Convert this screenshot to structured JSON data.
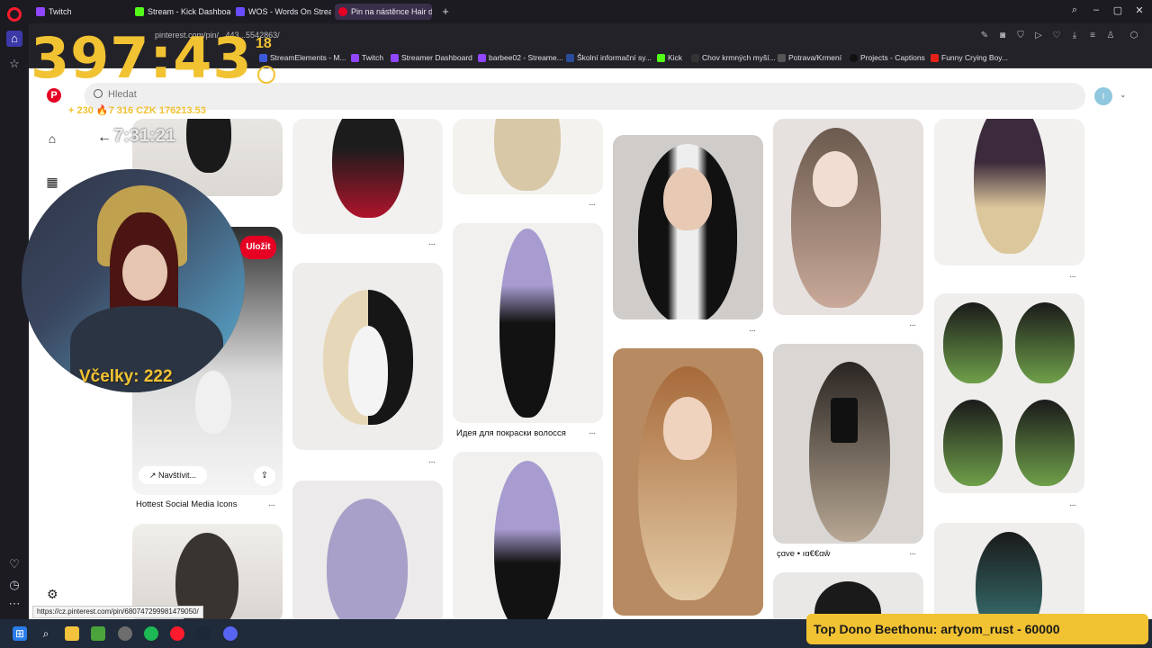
{
  "browser": {
    "tabs": [
      {
        "label": "Twitch",
        "color": "#9146ff"
      },
      {
        "label": "Stream - Kick Dashboard",
        "color": "#53fc18"
      },
      {
        "label": "WOS - Words On Stream",
        "color": "#6a4cff"
      },
      {
        "label": "Pin na nástěnce Hair doo",
        "color": "#e60023"
      }
    ],
    "url": "pinterest.com/pin/...443...5542863/",
    "bookmarks": [
      {
        "label": "StreamElements - M...",
        "color": "#3b5bdb"
      },
      {
        "label": "Twitch",
        "color": "#9146ff"
      },
      {
        "label": "Streamer Dashboard",
        "color": "#9146ff"
      },
      {
        "label": "barbee02 - Streame...",
        "color": "#9146ff"
      },
      {
        "label": "Školní informační sy...",
        "color": "#2a4d9b"
      },
      {
        "label": "Kick",
        "color": "#53fc18"
      },
      {
        "label": "Chov krmných myší...",
        "color": "#333333"
      },
      {
        "label": "Potrava/Krmení",
        "color": "#555555"
      },
      {
        "label": "Projects - Captions",
        "color": "#111111"
      },
      {
        "label": "Funny Crying Boy...",
        "color": "#e62117"
      }
    ],
    "status_url": "https://cz.pinterest.com/pin/680747299981479050/"
  },
  "pinterest": {
    "search_placeholder": "Hledat",
    "avatar_letter": "I",
    "save_label": "Uložit",
    "visit_label": "Navštívit...",
    "pin_titles": {
      "social": "Hottest Social Media Icons",
      "russian": "Идея для покраски волосся",
      "cave": "çɑve • ıɑ€€ɑŵ"
    }
  },
  "overlay": {
    "timer": "397:43",
    "timer_sub": "18",
    "stats": "+ 230  🔥7 316  CZK 176213.53",
    "clock": "7:31:21",
    "vcelky": "Včelky: 222",
    "top_dono": "Top Dono Beethonu: artyom_rust - 60000"
  },
  "colors": {
    "accent": "#e60023",
    "overlay_gold": "#f1c232",
    "browser_dark": "#1c1b22"
  }
}
